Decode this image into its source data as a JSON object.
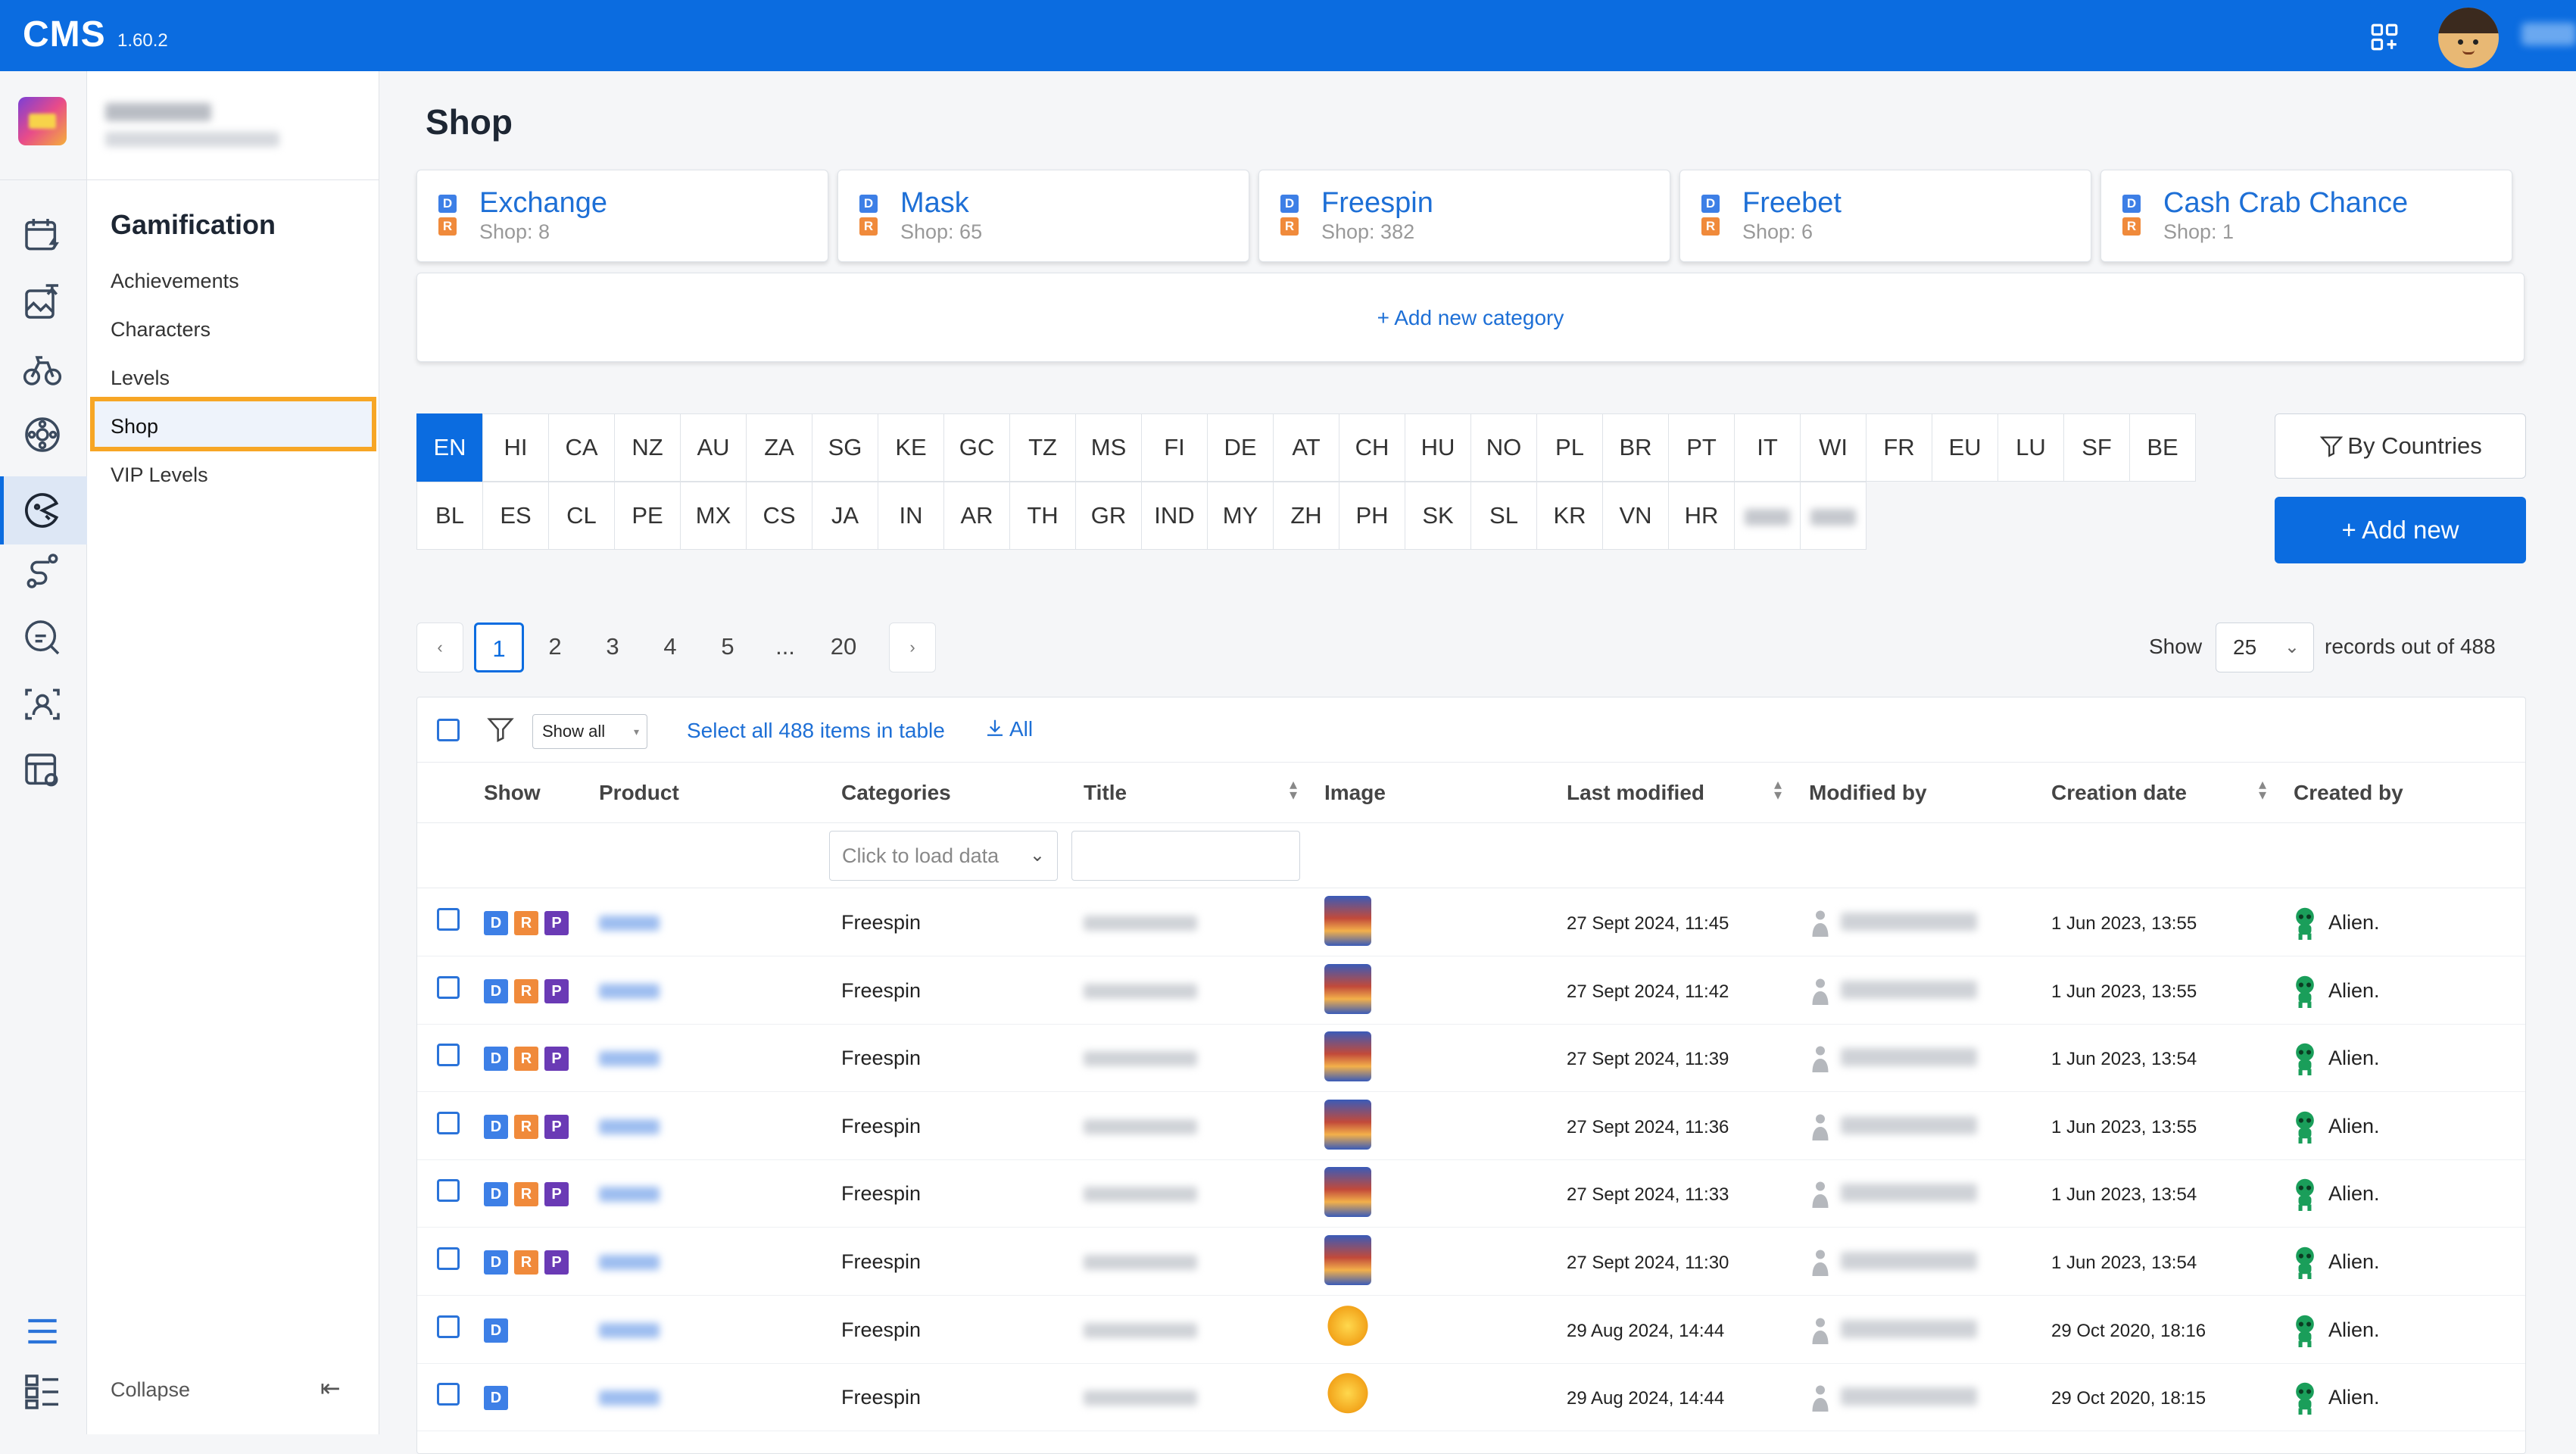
{
  "app": {
    "brand": "CMS",
    "version": "1.60.2"
  },
  "sidebar": {
    "section_title": "Gamification",
    "items": [
      {
        "label": "Achievements"
      },
      {
        "label": "Characters"
      },
      {
        "label": "Levels"
      },
      {
        "label": "Shop"
      },
      {
        "label": "VIP Levels"
      }
    ],
    "active_item": "Shop",
    "collapse_label": "Collapse"
  },
  "rail_icons": [
    "calendar-bolt-icon",
    "image-translate-icon",
    "bicycle-icon",
    "settings-wheel-icon",
    "pacman-gauge-icon",
    "route-icon",
    "search-chat-icon",
    "user-scan-icon",
    "layout-settings-icon",
    "menu-icon",
    "list-grid-icon"
  ],
  "page": {
    "title": "Shop"
  },
  "categories": [
    {
      "name": "Exchange",
      "count": "Shop: 8"
    },
    {
      "name": "Mask",
      "count": "Shop: 65"
    },
    {
      "name": "Freespin",
      "count": "Shop: 382"
    },
    {
      "name": "Freebet",
      "count": "Shop: 6"
    },
    {
      "name": "Cash Crab Chance",
      "count": "Shop: 1"
    }
  ],
  "category_badges": {
    "d": "D",
    "r": "R"
  },
  "add_category_label": "+ Add new category",
  "languages": {
    "row1": [
      "EN",
      "HI",
      "CA",
      "NZ",
      "AU",
      "ZA",
      "SG",
      "KE",
      "GC",
      "TZ",
      "MS",
      "FI",
      "DE",
      "AT",
      "CH",
      "HU",
      "NO",
      "PL",
      "BR",
      "PT",
      "IT",
      "WI",
      "FR",
      "EU",
      "LU",
      "SF",
      "BE"
    ],
    "row2": [
      "BL",
      "ES",
      "CL",
      "PE",
      "MX",
      "CS",
      "JA",
      "IN",
      "AR",
      "TH",
      "GR",
      "IND",
      "MY",
      "ZH",
      "PH",
      "SK",
      "SL",
      "KR",
      "VN",
      "HR"
    ],
    "active": "EN"
  },
  "buttons": {
    "by_countries": "By Countries",
    "add_new": "+ Add new"
  },
  "pagination": {
    "pages": [
      "1",
      "2",
      "3",
      "4",
      "5",
      "...",
      "20"
    ],
    "current": "1",
    "prev": "‹",
    "next": "›"
  },
  "page_size": {
    "show_label": "Show",
    "value": "25",
    "records_label": "records out of 488"
  },
  "table_toolbar": {
    "show_filter": "Show all",
    "select_all": "Select all 488 items in table",
    "download": "All"
  },
  "columns": [
    "Show",
    "Product",
    "Categories",
    "Title",
    "Image",
    "Last modified",
    "Modified by",
    "Creation date",
    "Created by"
  ],
  "filters": {
    "categories_placeholder": "Click to load data"
  },
  "rows": [
    {
      "badges": [
        "D",
        "R",
        "P"
      ],
      "category": "Freespin",
      "image": "slot",
      "last_modified": "27 Sept 2024, 11:45",
      "creation_date": "1 Jun 2023, 13:55",
      "created_by": "Alien."
    },
    {
      "badges": [
        "D",
        "R",
        "P"
      ],
      "category": "Freespin",
      "image": "slot",
      "last_modified": "27 Sept 2024, 11:42",
      "creation_date": "1 Jun 2023, 13:55",
      "created_by": "Alien."
    },
    {
      "badges": [
        "D",
        "R",
        "P"
      ],
      "category": "Freespin",
      "image": "slot",
      "last_modified": "27 Sept 2024, 11:39",
      "creation_date": "1 Jun 2023, 13:54",
      "created_by": "Alien."
    },
    {
      "badges": [
        "D",
        "R",
        "P"
      ],
      "category": "Freespin",
      "image": "slot",
      "last_modified": "27 Sept 2024, 11:36",
      "creation_date": "1 Jun 2023, 13:55",
      "created_by": "Alien."
    },
    {
      "badges": [
        "D",
        "R",
        "P"
      ],
      "category": "Freespin",
      "image": "slot",
      "last_modified": "27 Sept 2024, 11:33",
      "creation_date": "1 Jun 2023, 13:54",
      "created_by": "Alien."
    },
    {
      "badges": [
        "D",
        "R",
        "P"
      ],
      "category": "Freespin",
      "image": "slot",
      "last_modified": "27 Sept 2024, 11:30",
      "creation_date": "1 Jun 2023, 13:54",
      "created_by": "Alien."
    },
    {
      "badges": [
        "D"
      ],
      "category": "Freespin",
      "image": "gold",
      "last_modified": "29 Aug 2024, 14:44",
      "creation_date": "29 Oct 2020, 18:16",
      "created_by": "Alien."
    },
    {
      "badges": [
        "D"
      ],
      "category": "Freespin",
      "image": "gold",
      "last_modified": "29 Aug 2024, 14:44",
      "creation_date": "29 Oct 2020, 18:15",
      "created_by": "Alien."
    }
  ],
  "colors": {
    "primary": "#0b6ce0",
    "highlight": "#f7a625",
    "badge_d": "#3d7fe6",
    "badge_r": "#f08a3b",
    "badge_p": "#6a3ab5"
  }
}
